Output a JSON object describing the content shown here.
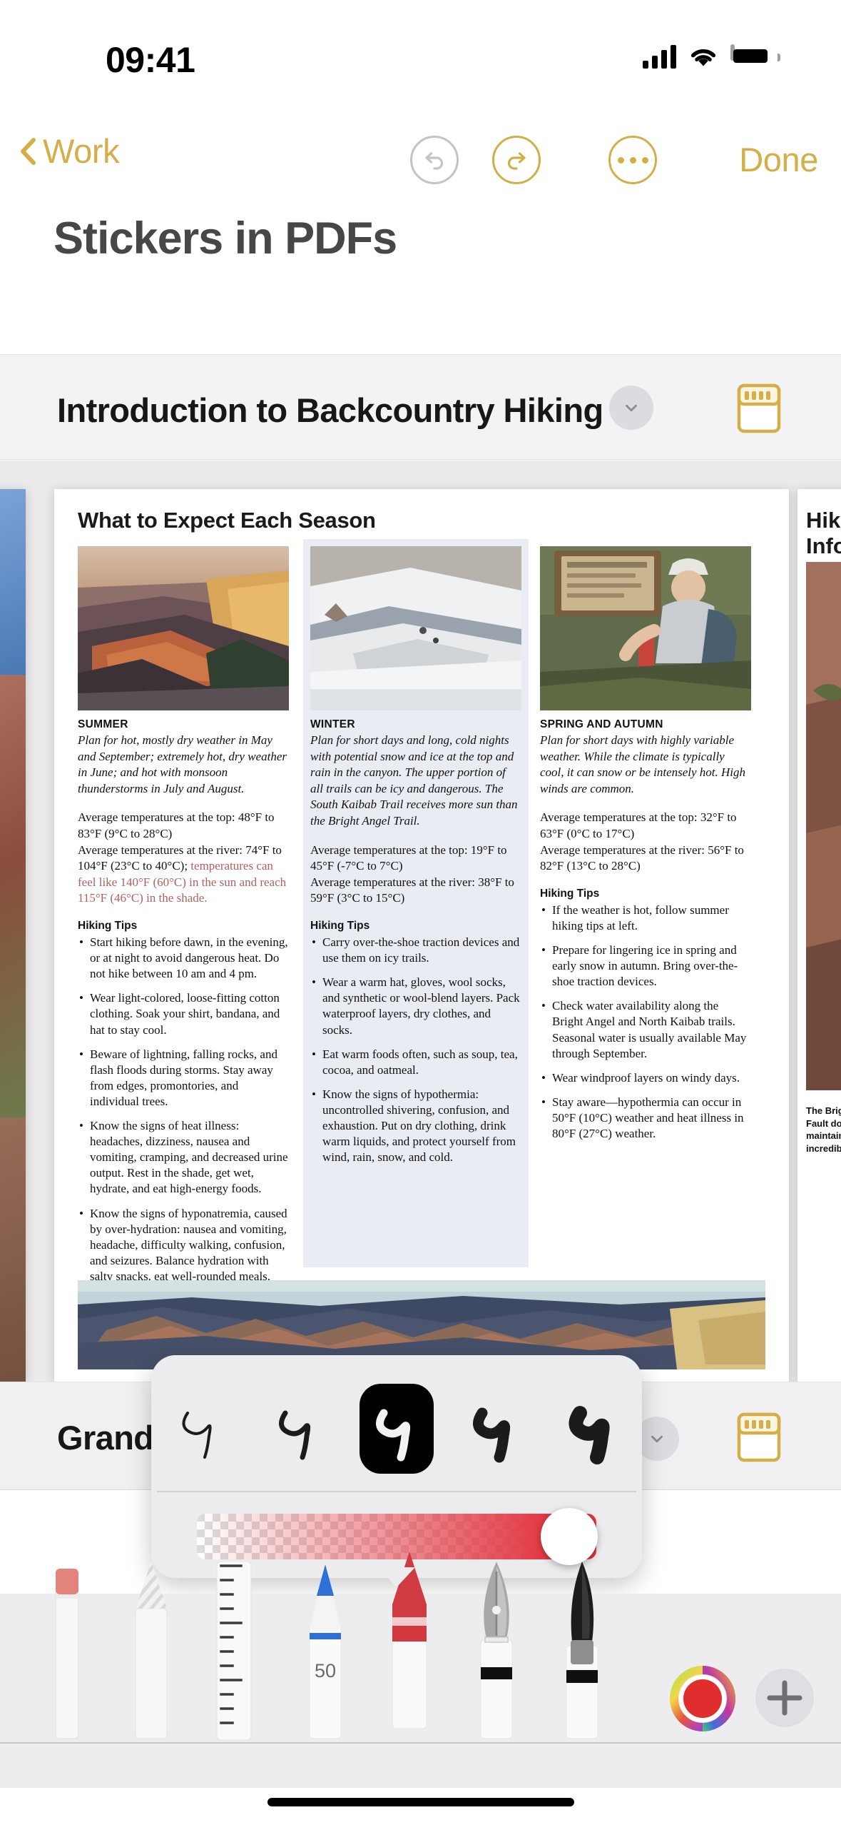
{
  "status_bar": {
    "time": "09:41",
    "cellular_icon": "cellular-bars-icon",
    "wifi_icon": "wifi-icon",
    "battery_icon": "battery-full-icon"
  },
  "nav_bar": {
    "back_label": "Work",
    "back_icon": "chevron-left-icon",
    "undo_icon": "undo-icon",
    "undo_enabled": false,
    "redo_icon": "redo-icon",
    "more_icon": "more-ellipsis-icon",
    "done_label": "Done",
    "accent_color": "#d4af49",
    "disabled_color": "#c4c4c6"
  },
  "document": {
    "title": "Stickers in PDFs"
  },
  "chapters": [
    {
      "title": "Introduction to Backcountry Hiking",
      "collapse_icon": "chevron-down-icon",
      "grid_icon": "page-thumbnails-icon"
    },
    {
      "title": "Grand Canyon Pocket Map: South…",
      "collapse_icon": "chevron-down-icon",
      "grid_icon": "page-thumbnails-icon"
    }
  ],
  "pdf_page": {
    "heading": "What to Expect Each Season",
    "columns": [
      {
        "season": "SUMMER",
        "photo_alt": "grand-canyon-sunrise-photo",
        "intro": "Plan for hot, mostly dry weather in May and September; extremely hot, dry weather in June; and hot with monsoon thunderstorms in July and August.",
        "temp_top": "Average temperatures at the top: 48°F to 83°F (9°C to 28°C)",
        "temp_river_plain": "Average temperatures at the river: 74°F to 104°F (23°C to 40°C); ",
        "temp_river_warn": "temperatures can feel like 140°F (60°C) in the sun and reach 115°F (46°C) in the shade.",
        "tips_heading": "Hiking Tips",
        "tips": [
          "Start hiking before dawn, in the evening, or at night to avoid dangerous heat. Do not hike between 10 am and 4 pm.",
          "Wear light-colored, loose-fitting cotton clothing. Soak your shirt, bandana, and hat to stay cool.",
          "Beware of lightning, falling rocks, and flash floods during storms. Stay away from edges, promontories, and individual trees.",
          "Know the signs of heat illness: headaches, dizziness, nausea and vomiting, cramping, and decreased urine output. Rest in the shade, get wet, hydrate, and eat high-energy foods.",
          "Know the signs of hyponatremia, caused by over-hydration: nausea and vomiting, headache, difficulty walking, confusion, and seizures. Balance hydration with salty snacks, eat well-rounded meals, and rest frequently."
        ]
      },
      {
        "season": "WINTER",
        "photo_alt": "snowy-canyon-trail-photo",
        "intro": "Plan for short days and long, cold nights with potential snow and ice at the top and rain in the canyon. The upper portion of all trails can be icy and dangerous. The South Kaibab Trail receives more sun than the Bright Angel Trail.",
        "temp_top": "Average temperatures at the top: 19°F to 45°F (-7°C to 7°C)",
        "temp_river_plain": "Average temperatures at the river: 38°F to 59°F (3°C to 15°C)",
        "temp_river_warn": "",
        "tips_heading": "Hiking Tips",
        "tips": [
          "Carry over-the-shoe traction devices and use them on icy trails.",
          "Wear a warm hat, gloves, wool socks, and synthetic or wool-blend layers. Pack waterproof layers, dry clothes, and socks.",
          "Eat warm foods often, such as soup, tea, cocoa, and oatmeal.",
          "Know the signs of hypothermia: uncontrolled shivering, confusion, and exhaustion. Put on dry clothing, drink warm liquids, and protect yourself from wind, rain, snow, and cold."
        ]
      },
      {
        "season": "SPRING AND AUTUMN",
        "photo_alt": "hiker-filling-water-bottle-photo",
        "intro": "Plan for short days with highly variable weather. While the climate is typically cool, it can snow or be intensely hot. High winds are common.",
        "temp_top": "Average temperatures at the top: 32°F to 63°F (0°C to 17°C)",
        "temp_river_plain": "Average temperatures at the river: 56°F to 82°F (13°C to 28°C)",
        "temp_river_warn": "",
        "tips_heading": "Hiking Tips",
        "tips": [
          "If the weather is hot, follow summer hiking tips at left.",
          "Prepare for lingering ice in spring and early snow in autumn. Bring over-the-shoe traction devices.",
          "Check water availability along the Bright Angel and North Kaibab trails. Seasonal water is usually available May through September.",
          "Wear windproof layers on windy days.",
          "Stay aware—hypothermia can occur in 50°F (10°C) weather and heat illness in 80°F (27°C) weather."
        ]
      }
    ],
    "panorama_alt": "grand-canyon-panorama-photo",
    "next_page_fragment": {
      "title_line1": "Hikin",
      "title_line2": "Infor",
      "caption": "The Brigh\nFault dow\nmaintaine\nincredibly"
    }
  },
  "stroke_picker": {
    "strokes": [
      {
        "name": "stroke-thin",
        "width": 4,
        "selected": false
      },
      {
        "name": "stroke-light",
        "width": 7,
        "selected": false
      },
      {
        "name": "stroke-medium",
        "width": 11,
        "selected": true
      },
      {
        "name": "stroke-heavy",
        "width": 15,
        "selected": false
      },
      {
        "name": "stroke-extra-heavy",
        "width": 20,
        "selected": false
      }
    ],
    "opacity_slider": {
      "name": "opacity-slider",
      "value_percent": 95,
      "color": "#e23842"
    }
  },
  "tool_palette": {
    "tools": [
      {
        "name": "eraser-tool",
        "label": "Eraser",
        "selected": false
      },
      {
        "name": "pencil-tool",
        "label": "Pencil",
        "selected": false
      },
      {
        "name": "ruler-tool",
        "label": "Ruler",
        "selected": false
      },
      {
        "name": "pen-tool",
        "label": "Pen",
        "selected": false,
        "size_value": "50"
      },
      {
        "name": "crayon-tool",
        "label": "Crayon",
        "selected": true
      },
      {
        "name": "fountain-pen-tool",
        "label": "Fountain Pen",
        "selected": false
      },
      {
        "name": "marker-tool",
        "label": "Marker",
        "selected": false
      }
    ],
    "color_well": {
      "name": "color-picker-button",
      "current_color": "#e02d2d"
    },
    "add_button": {
      "name": "add-tool-button",
      "glyph": "+"
    }
  },
  "home_indicator": {
    "name": "home-indicator"
  }
}
